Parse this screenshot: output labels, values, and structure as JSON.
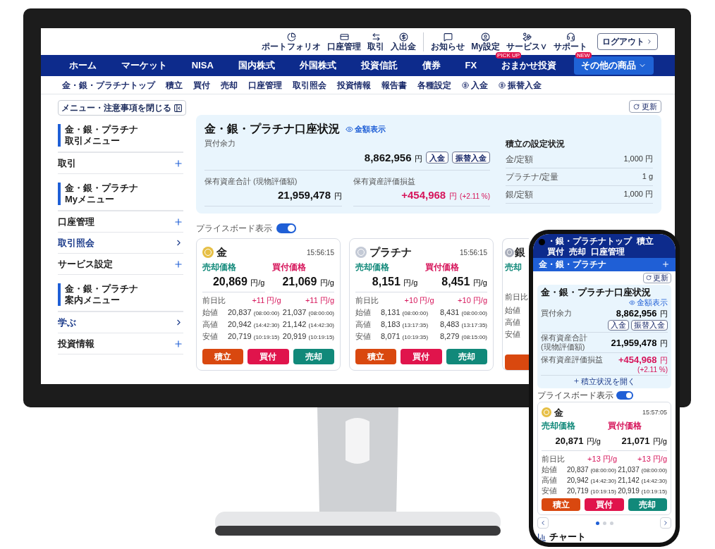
{
  "utility_links": [
    [
      {
        "label": "ポートフォリオ"
      },
      {
        "label": "口座管理"
      },
      {
        "label": "取引"
      },
      {
        "label": "入出金"
      }
    ],
    [
      {
        "label": "お知らせ"
      },
      {
        "label": "My設定"
      },
      {
        "label": "サービス∨"
      },
      {
        "label": "サポート"
      }
    ]
  ],
  "logout_button": "ログアウト",
  "nav": [
    {
      "label": "ホーム"
    },
    {
      "label": "マーケット"
    },
    {
      "label": "NISA"
    },
    {
      "label": "国内株式"
    },
    {
      "label": "外国株式"
    },
    {
      "label": "投資信託"
    },
    {
      "label": "債券"
    },
    {
      "label": "FX"
    },
    {
      "label": "おまかせ投資",
      "badge": "PICK UP",
      "highlighted": false
    },
    {
      "label": "その他の商品",
      "badge": "NEW",
      "highlighted": true
    }
  ],
  "subnav": [
    {
      "label": "金・銀・プラチナトップ",
      "kind": "plain"
    },
    {
      "label": "積立",
      "kind": "plain"
    },
    {
      "label": "買付",
      "kind": "plain"
    },
    {
      "label": "売却",
      "kind": "plain"
    },
    {
      "label": "口座管理",
      "kind": "plain"
    },
    {
      "label": "取引照会",
      "kind": "plain"
    },
    {
      "label": "投資情報",
      "kind": "plain"
    },
    {
      "label": "報告書",
      "kind": "plain"
    },
    {
      "label": "各種設定",
      "kind": "plain"
    },
    {
      "label": "入金",
      "kind": "money"
    },
    {
      "label": "振替入金",
      "kind": "money"
    }
  ],
  "sidebar": {
    "close_button": "メニュー・注意事項を閉じる",
    "items": [
      {
        "kind": "heading",
        "lines": [
          "金・銀・プラチナ",
          "取引メニュー"
        ]
      },
      {
        "kind": "expand",
        "label": "取引"
      },
      {
        "kind": "heading",
        "lines": [
          "金・銀・プラチナ",
          "Myメニュー"
        ]
      },
      {
        "kind": "expand",
        "label": "口座管理"
      },
      {
        "kind": "link",
        "label": "取引照会"
      },
      {
        "kind": "expand",
        "label": "サービス設定"
      },
      {
        "kind": "heading",
        "lines": [
          "金・銀・プラチナ",
          "案内メニュー"
        ]
      },
      {
        "kind": "link",
        "label": "学ぶ"
      },
      {
        "kind": "expand",
        "label": "投資情報"
      }
    ]
  },
  "refresh_button": "更新",
  "account": {
    "title": "金・銀・プラチナ口座状況",
    "show_amount": "金額表示",
    "buying_power": {
      "label": "買付余力",
      "value": "8,862,956",
      "unit": "円",
      "buttons": [
        "入金",
        "振替入金"
      ]
    },
    "holdings": {
      "label": "保有資産合計 (現物評価額)",
      "value": "21,959,478",
      "unit": "円"
    },
    "pnl": {
      "label": "保有資産評価損益",
      "value": "+454,968",
      "unit": "円",
      "percent": "(+2.11 %)"
    },
    "plan": {
      "title": "積立の設定状況",
      "rows": [
        {
          "label": "金/定額",
          "value": "1,000 円"
        },
        {
          "label": "プラチナ/定量",
          "value": "1 g"
        },
        {
          "label": "銀/定額",
          "value": "1,000 円"
        }
      ]
    }
  },
  "price_board": {
    "label": "プライスボード表示",
    "on": true
  },
  "cards": [
    {
      "name": "金",
      "color": "#e6bf45",
      "time": "15:56:15",
      "sell_label": "売却価格",
      "buy_label": "買付価格",
      "sell_price": "20,869",
      "sell_unit": "円/g",
      "buy_price": "21,069",
      "buy_unit": "円/g",
      "change_label": "前日比",
      "sell_change": "+11 円/g",
      "buy_change": "+11 円/g",
      "rows": [
        {
          "label": "始値",
          "sell": "20,837",
          "sell_time": "(08:00:00)",
          "buy": "21,037",
          "buy_time": "(08:00:00)"
        },
        {
          "label": "高値",
          "sell": "20,942",
          "sell_time": "(14:42:30)",
          "buy": "21,142",
          "buy_time": "(14:42:30)"
        },
        {
          "label": "安値",
          "sell": "20,719",
          "sell_time": "(10:19:15)",
          "buy": "20,919",
          "buy_time": "(10:19:15)"
        }
      ],
      "buttons": [
        {
          "label": "積立",
          "kind": "accumulate"
        },
        {
          "label": "買付",
          "kind": "buy"
        },
        {
          "label": "売却",
          "kind": "sell"
        }
      ]
    },
    {
      "name": "プラチナ",
      "color": "#c4cad6",
      "time": "15:56:15",
      "sell_label": "売却価格",
      "buy_label": "買付価格",
      "sell_price": "8,151",
      "sell_unit": "円/g",
      "buy_price": "8,451",
      "buy_unit": "円/g",
      "change_label": "前日比",
      "sell_change": "+10 円/g",
      "buy_change": "+10 円/g",
      "rows": [
        {
          "label": "始値",
          "sell": "8,131",
          "sell_time": "(08:00:00)",
          "buy": "8,431",
          "buy_time": "(08:00:00)"
        },
        {
          "label": "高値",
          "sell": "8,183",
          "sell_time": "(13:17:35)",
          "buy": "8,483",
          "buy_time": "(13:17:35)"
        },
        {
          "label": "安値",
          "sell": "8,071",
          "sell_time": "(10:19:35)",
          "buy": "8,279",
          "buy_time": "(08:15:00)"
        }
      ],
      "buttons": [
        {
          "label": "積立",
          "kind": "accumulate"
        },
        {
          "label": "買付",
          "kind": "buy"
        },
        {
          "label": "売却",
          "kind": "sell"
        }
      ]
    }
  ],
  "partial_card": {
    "name": "銀",
    "color": "#a9aebb",
    "sell_label": "売却",
    "row_labels": [
      "前日比",
      "始値",
      "高値",
      "安値"
    ]
  },
  "phone": {
    "top_nav": [
      "・銀・プラチナトップ",
      "積立",
      "買付",
      "売却",
      "口座管理"
    ],
    "section_title": "金・銀・プラチナ",
    "refresh_button": "更新",
    "account": {
      "title": "金・銀・プラチナ口座状況",
      "show_amount": "金額表示",
      "buying_power": {
        "label": "買付余力",
        "value": "8,862,956",
        "unit": "円",
        "buttons": [
          "入金",
          "振替入金"
        ]
      },
      "holdings": {
        "lines": [
          "保有資産合計",
          "(現物評価額)"
        ],
        "value": "21,959,478",
        "unit": "円"
      },
      "pnl": {
        "label": "保有資産評価損益",
        "value": "+454,968",
        "unit": "円",
        "percent": "(+2.11 %)"
      },
      "open_plan": "積立状況を開く"
    },
    "price_board": {
      "label": "プライスボード表示",
      "on": true
    },
    "card": {
      "name": "金",
      "color": "#e6bf45",
      "time": "15:57:05",
      "sell_label": "売却価格",
      "buy_label": "買付価格",
      "sell_price": "20,871",
      "sell_unit": "円/g",
      "buy_price": "21,071",
      "buy_unit": "円/g",
      "change_label": "前日比",
      "sell_change": "+13 円/g",
      "buy_change": "+13 円/g",
      "rows": [
        {
          "label": "始値",
          "sell": "20,837",
          "sell_time": "(08:00:00)",
          "buy": "21,037",
          "buy_time": "(08:00:00)"
        },
        {
          "label": "高値",
          "sell": "20,942",
          "sell_time": "(14:42:30)",
          "buy": "21,142",
          "buy_time": "(14:42:30)"
        },
        {
          "label": "安値",
          "sell": "20,719",
          "sell_time": "(10:19:15)",
          "buy": "20,919",
          "buy_time": "(10:19:15)"
        }
      ],
      "buttons": [
        {
          "label": "積立",
          "kind": "accumulate"
        },
        {
          "label": "買付",
          "kind": "buy"
        },
        {
          "label": "売却",
          "kind": "sell"
        }
      ]
    },
    "dots": [
      {
        "selected": true
      },
      {
        "selected": false
      },
      {
        "selected": false
      }
    ],
    "chart_title": "チャート"
  }
}
